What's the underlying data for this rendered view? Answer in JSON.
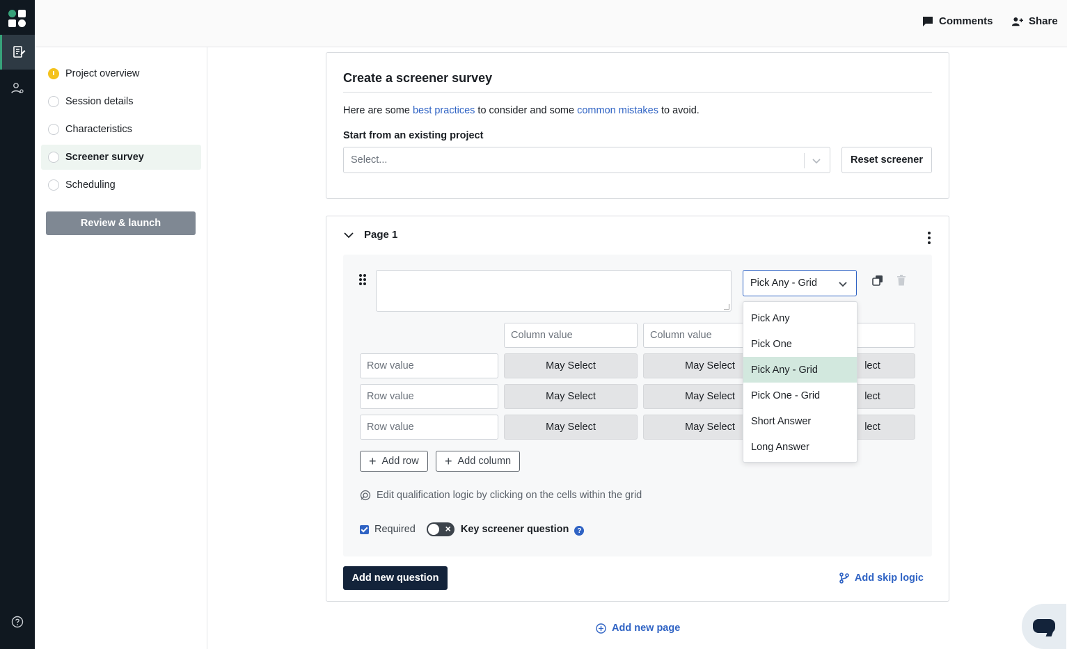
{
  "topbar": {
    "comments_label": "Comments",
    "share_label": "Share"
  },
  "sidenav": {
    "items": [
      {
        "label": "Project overview",
        "status": "warning"
      },
      {
        "label": "Session details",
        "status": "empty"
      },
      {
        "label": "Characteristics",
        "status": "empty"
      },
      {
        "label": "Screener survey",
        "status": "active"
      },
      {
        "label": "Scheduling",
        "status": "empty"
      }
    ],
    "launch_label": "Review & launch"
  },
  "screener": {
    "title": "Create a screener survey",
    "intro_pre": "Here are some ",
    "intro_link1": "best practices",
    "intro_mid": " to consider and some ",
    "intro_link2": "common mistakes",
    "intro_post": " to avoid.",
    "existing_label": "Start from an existing project",
    "select_placeholder": "Select...",
    "reset_label": "Reset screener"
  },
  "page": {
    "title": "Page 1",
    "question_type": "Pick Any - Grid",
    "columns": [
      "Column value",
      "Column value",
      ""
    ],
    "rows": [
      {
        "label": "Row value",
        "cells": [
          "May Select",
          "May Select",
          "lect"
        ]
      },
      {
        "label": "Row value",
        "cells": [
          "May Select",
          "May Select",
          "lect"
        ]
      },
      {
        "label": "Row value",
        "cells": [
          "May Select",
          "May Select",
          "lect"
        ]
      }
    ],
    "add_row_label": "Add row",
    "add_column_label": "Add column",
    "hint": "Edit qualification logic by clicking on the cells within the grid",
    "required_label": "Required",
    "required_checked": true,
    "key_question_label": "Key screener question",
    "key_question_on": false,
    "help_glyph": "?",
    "add_question_label": "Add new question",
    "skip_logic_label": "Add skip logic"
  },
  "add_page_label": "Add new page",
  "dropdown": {
    "options": [
      "Pick Any",
      "Pick One",
      "Pick Any - Grid",
      "Pick One - Grid",
      "Short Answer",
      "Long Answer"
    ],
    "selected": "Pick Any - Grid"
  },
  "colors": {
    "rail": "#101820",
    "accent_green": "#37a27a",
    "link_blue": "#2f63c4",
    "primary_navy": "#13233a",
    "selected_option": "#d2e8de",
    "warning": "#f4c21d"
  }
}
